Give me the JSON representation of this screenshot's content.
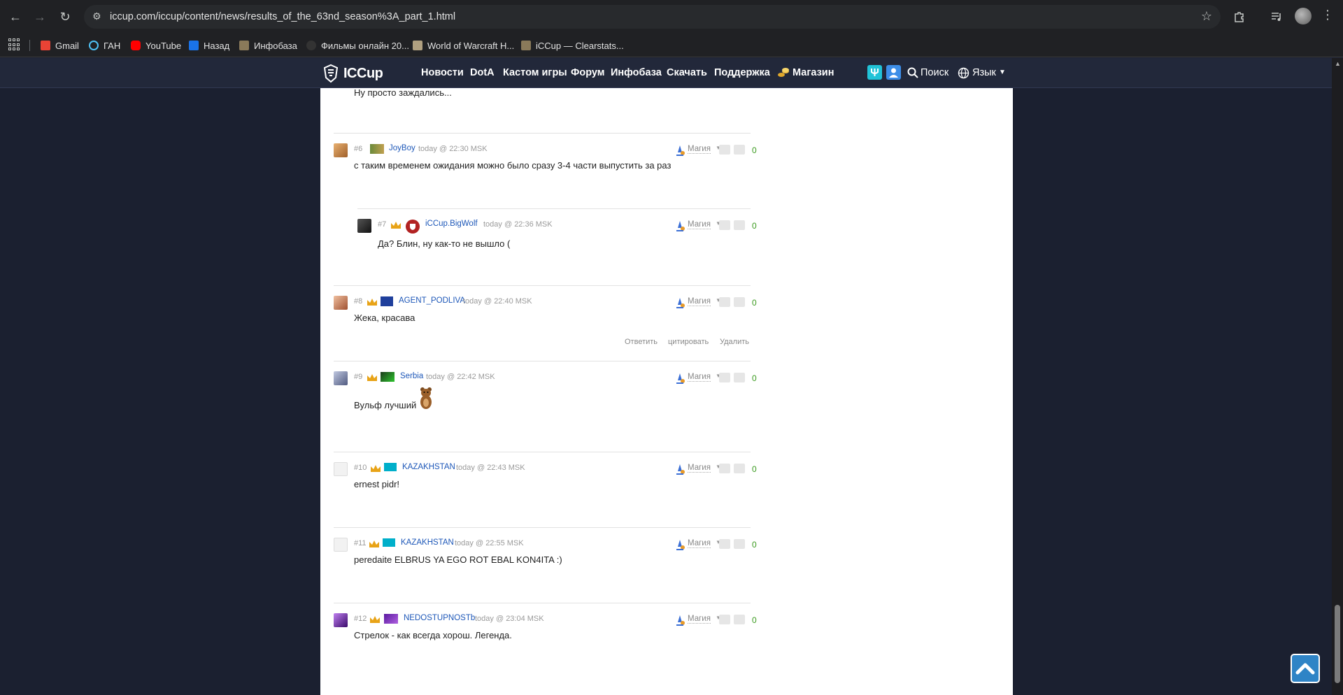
{
  "browser": {
    "url": "iccup.com/iccup/content/news/results_of_the_63nd_season%3A_part_1.html",
    "bookmarks": [
      {
        "label": "Gmail",
        "color": "#ea4335"
      },
      {
        "label": "ГАН",
        "color": "#4fc3f7"
      },
      {
        "label": "YouTube",
        "color": "#ff0000"
      },
      {
        "label": "Назад",
        "color": "#1a73e8"
      },
      {
        "label": "Инфобаза",
        "color": "#8a7a5a"
      },
      {
        "label": "Фильмы онлайн 20...",
        "color": "#333333"
      },
      {
        "label": "World of Warcraft H...",
        "color": "#b0a080"
      },
      {
        "label": "iCCup — Clearstats...",
        "color": "#8a7a5a"
      }
    ]
  },
  "site": {
    "logo_text": "ICCup",
    "menu": [
      "Новости",
      "DotA",
      "Кастом игры",
      "Форум",
      "Инфобаза",
      "Скачать",
      "Поддержка",
      "Магазин"
    ],
    "search_label": "Поиск",
    "language_label": "Язык"
  },
  "comments": {
    "prev_text": "Ну просто заждались...",
    "items": [
      {
        "num": "#6",
        "user": "JoyBoy",
        "time": "today @ 22:30 MSK",
        "text": "с таким временем ожидания можно было сразу 3-4 части выпустить за раз",
        "magic": "Магия",
        "score": "0"
      },
      {
        "num": "#7",
        "user": "iCCup.BigWolf",
        "time": "today @ 22:36 MSK",
        "text": "Да? Блин, ну как-то не вышло (",
        "magic": "Магия",
        "score": "0"
      },
      {
        "num": "#8",
        "user": "AGENT_PODLIVA",
        "time": "today @ 22:40 MSK",
        "text": "Жека, красава",
        "magic": "Магия",
        "score": "0"
      },
      {
        "num": "#9",
        "user": "Serbia",
        "time": "today @ 22:42 MSK",
        "text": "Вульф лучший",
        "magic": "Магия",
        "score": "0"
      },
      {
        "num": "#10",
        "user": "KAZAKHSTAN",
        "time": "today @ 22:43 MSK",
        "text": "ernest pidr!",
        "magic": "Магия",
        "score": "0"
      },
      {
        "num": "#11",
        "user": "KAZAKHSTAN",
        "time": "today @ 22:55 MSK",
        "text": "peredaite ELBRUS YA EGO ROT EBAL KON4ITA :)",
        "magic": "Магия",
        "score": "0"
      },
      {
        "num": "#12",
        "user": "NEDOSTUPNOSTb",
        "time": "today @ 23:04 MSK",
        "text": "Стрелок - как всегда хорош. Легенда.",
        "magic": "Магия",
        "score": "0"
      }
    ],
    "actions": {
      "reply": "Ответить",
      "quote": "цитировать",
      "delete": "Удалить"
    }
  },
  "colors": {
    "accent": "#2f84c6",
    "link": "#1d57b8",
    "score": "#3a9a1e"
  }
}
